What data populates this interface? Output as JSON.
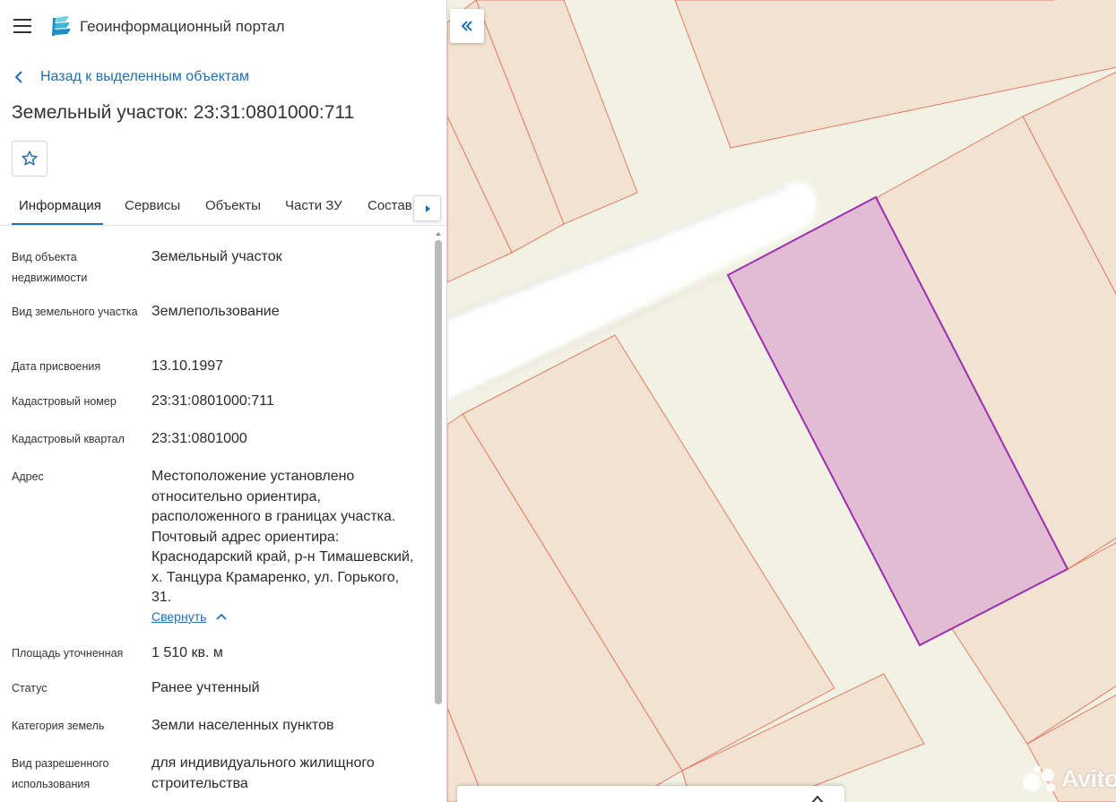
{
  "app": {
    "title": "Геоинформационный портал"
  },
  "nav": {
    "back_label": "Назад к выделенным объектам"
  },
  "object": {
    "title": "Земельный участок: 23:31:0801000:711"
  },
  "tabs": [
    {
      "label": "Информация",
      "active": true
    },
    {
      "label": "Сервисы",
      "active": false
    },
    {
      "label": "Объекты",
      "active": false
    },
    {
      "label": "Части ЗУ",
      "active": false
    },
    {
      "label": "Состав",
      "active": false
    }
  ],
  "info": {
    "fields": [
      {
        "label": "Вид объекта недвижимости",
        "value": "Земельный участок"
      },
      {
        "label": "Вид земельного участка",
        "value": "Землепользование"
      },
      {
        "label": "Дата присвоения",
        "value": "13.10.1997"
      },
      {
        "label": "Кадастровый номер",
        "value": "23:31:0801000:711"
      },
      {
        "label": "Кадастровый квартал",
        "value": "23:31:0801000"
      },
      {
        "label": "Адрес",
        "value": "Местоположение установлено относительно ориентира, расположенного в границах участка. Почтовый адрес ориентира: Краснодарский край, р-н Тимашевский, х. Танцура Крамаренко, ул. Горького, 31."
      },
      {
        "label": "Площадь уточненная",
        "value": "1 510 кв. м"
      },
      {
        "label": "Статус",
        "value": "Ранее учтенный"
      },
      {
        "label": "Категория земель",
        "value": "Земли населенных пунктов"
      },
      {
        "label": "Вид разрешенного использования",
        "value": "для индивидуального жилищного строительства"
      }
    ],
    "collapse_label": "Свернуть"
  },
  "map": {
    "watermark": "Avito",
    "colors": {
      "road": "#f1f1e4",
      "parcel_fill": "#f2e2d1",
      "parcel_border": "#e47b64",
      "selected_fill": "#e2bcd3",
      "selected_border": "#9b2fb1"
    }
  },
  "icons": {
    "menu": "menu-icon",
    "logo": "portal-logo-icon",
    "back": "chevron-left-icon",
    "favorite": "star-outline-icon",
    "tabs_next": "triangle-right-icon",
    "collapse": "chevron-up-icon",
    "panel_toggle": "double-chevron-left-icon"
  }
}
